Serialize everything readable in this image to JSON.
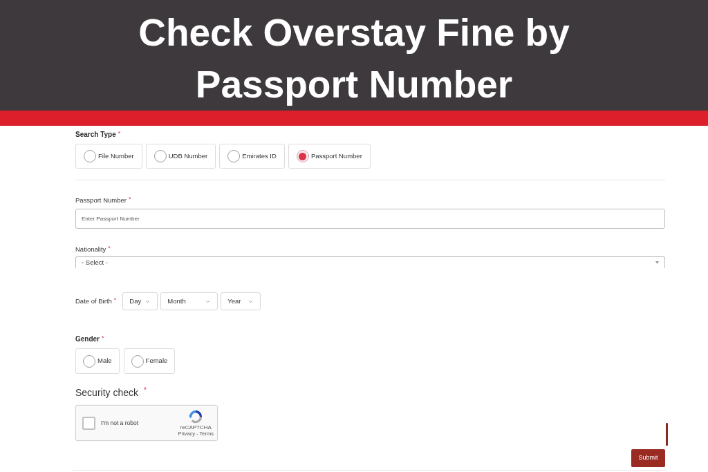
{
  "banner": {
    "title": "Check Overstay Fine by Passport Number"
  },
  "form": {
    "search_type": {
      "label": "Search Type",
      "required_mark": "*",
      "options": [
        {
          "label": "File Number",
          "selected": false
        },
        {
          "label": "UDB Number",
          "selected": false
        },
        {
          "label": "Emirates ID",
          "selected": false
        },
        {
          "label": "Passport Number",
          "selected": true
        }
      ]
    },
    "passport_number": {
      "label": "Passport Number",
      "required_mark": "*",
      "placeholder": "Enter Passport Number"
    },
    "nationality": {
      "label": "Nationality",
      "required_mark": "*",
      "value": "- Select -"
    },
    "date_of_birth": {
      "label": "Date of Birth",
      "required_mark": "*",
      "selects": [
        {
          "value": "Day"
        },
        {
          "value": "Month"
        },
        {
          "value": "Year"
        }
      ]
    },
    "gender": {
      "label": "Gender",
      "required_mark": "*",
      "options": [
        {
          "label": "Male",
          "selected": false
        },
        {
          "label": "Female",
          "selected": false
        }
      ]
    },
    "security_check": {
      "label": "Security check",
      "required_mark": "*",
      "captcha": {
        "label": "I'm not a robot",
        "checked": false,
        "brand": "reCAPTCHA",
        "links": "Privacy - Terms"
      }
    },
    "submit_button": {
      "label": "Submit"
    }
  }
}
